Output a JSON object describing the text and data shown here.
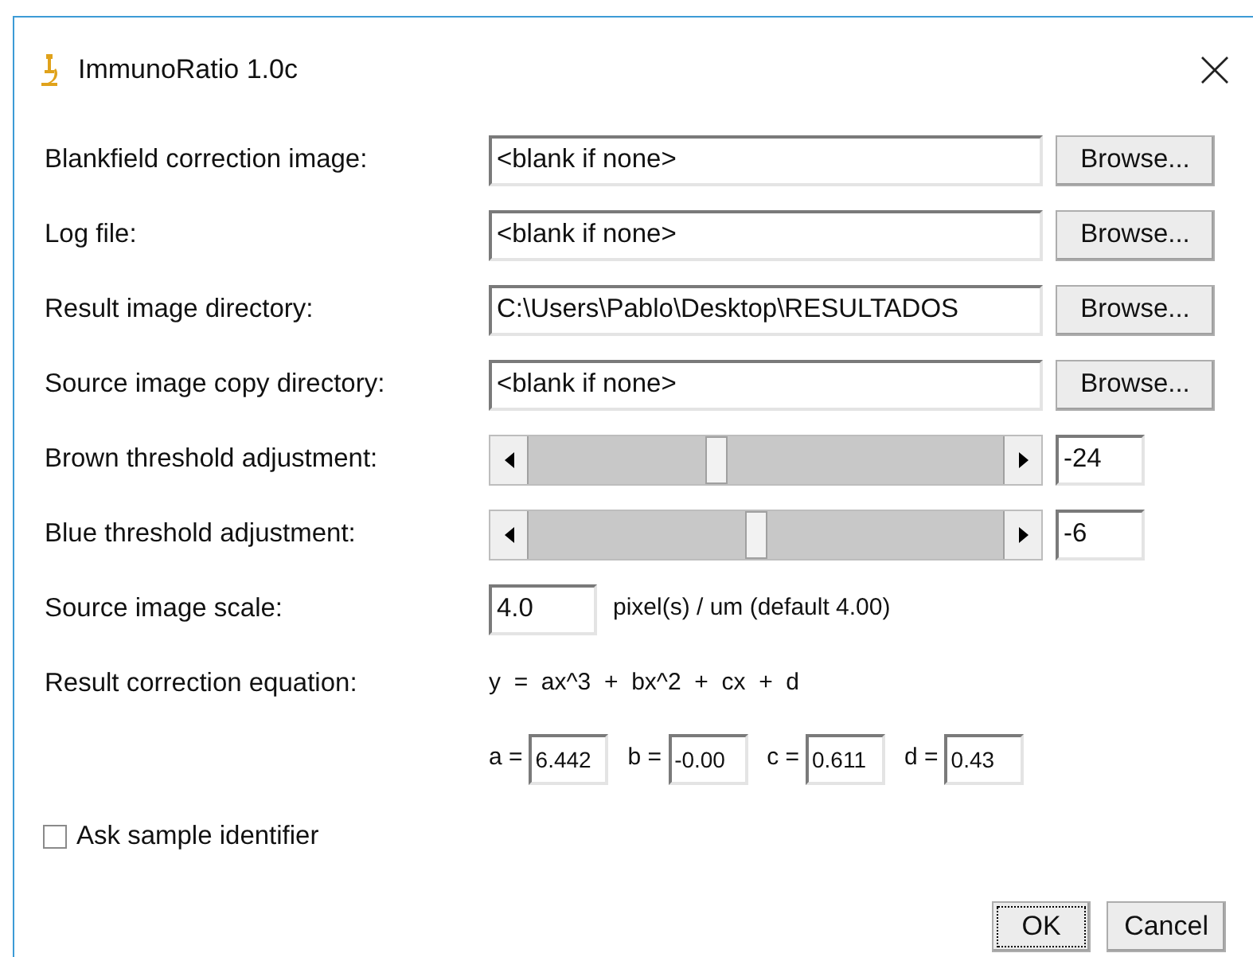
{
  "window": {
    "title": "ImmunoRatio 1.0c"
  },
  "file_rows": [
    {
      "label": "Blankfield correction image:",
      "value": "<blank if none>",
      "button": "Browse..."
    },
    {
      "label": "Log file:",
      "value": "<blank if none>",
      "button": "Browse..."
    },
    {
      "label": "Result image directory:",
      "value": "C:\\Users\\Pablo\\Desktop\\RESULTADOS",
      "button": "Browse..."
    },
    {
      "label": "Source image copy directory:",
      "value": "<blank if none>",
      "button": "Browse..."
    }
  ],
  "sliders": [
    {
      "label": "Brown threshold adjustment:",
      "value": "-24"
    },
    {
      "label": "Blue threshold adjustment:",
      "value": "-6"
    }
  ],
  "scale": {
    "label": "Source image scale:",
    "value": "4.0",
    "unit": "pixel(s) / um (default 4.00)"
  },
  "correction": {
    "label": "Result correction equation:",
    "equation": "y  =  ax^3  +  bx^2  +  cx  +  d",
    "coefficients": [
      {
        "label": "a =",
        "value": "6.442"
      },
      {
        "label": "b =",
        "value": "-0.00"
      },
      {
        "label": "c =",
        "value": "0.611"
      },
      {
        "label": "d =",
        "value": "0.43"
      }
    ]
  },
  "checkbox": {
    "label": "Ask sample identifier",
    "checked": false
  },
  "buttons": [
    {
      "label": "OK",
      "focused": true
    },
    {
      "label": "Cancel",
      "focused": false
    }
  ]
}
